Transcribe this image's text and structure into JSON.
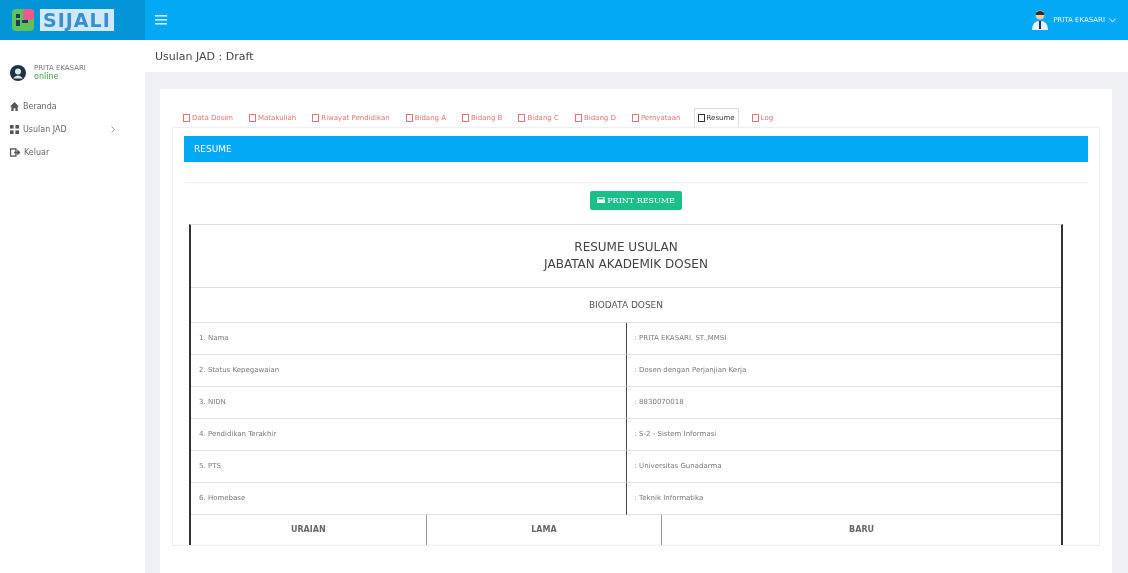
{
  "brand": {
    "name": "SIJALI"
  },
  "user_menu": {
    "name": "PRITA EKASARI"
  },
  "sidebar": {
    "user": {
      "name": "PRITA EKASARI",
      "status": "online"
    },
    "items": [
      {
        "label": "Beranda",
        "has_submenu": false
      },
      {
        "label": "Usulan JAD",
        "has_submenu": true
      },
      {
        "label": "Keluar",
        "has_submenu": false
      }
    ]
  },
  "page_title": "Usulan JAD : Draft",
  "tabs": [
    {
      "label": "Data Dosen",
      "selected": false
    },
    {
      "label": "Matakuliah",
      "selected": false
    },
    {
      "label": "Riwayat Pendidikan",
      "selected": false
    },
    {
      "label": "Bidang A",
      "selected": false
    },
    {
      "label": "Bidang B",
      "selected": false
    },
    {
      "label": "Bidang C",
      "selected": false
    },
    {
      "label": "Bidang D",
      "selected": false
    },
    {
      "label": "Pernyataan",
      "selected": false
    },
    {
      "label": "Resume",
      "selected": true
    },
    {
      "label": "Log",
      "selected": false
    }
  ],
  "section_title": "RESUME",
  "print_button": "PRINT RESUME",
  "resume": {
    "title_lines": [
      "RESUME USULAN",
      "JABATAN AKADEMIK DOSEN"
    ],
    "biodata_heading": "BIODATA DOSEN",
    "rows": [
      {
        "label": "1. Nama",
        "value": ": PRITA EKASARI, ST.,MMSI"
      },
      {
        "label": "2. Status Kepegawaian",
        "value": ": Dosen dengan Perjanjian Kerja"
      },
      {
        "label": "3. NIDN",
        "value": ": 8830070018"
      },
      {
        "label": "4. Pendidikan Terakhir",
        "value": ": S-2 - Sistem Informasi"
      },
      {
        "label": "5. PTS",
        "value": ": Universitas Gunadarma"
      },
      {
        "label": "6. Homebase",
        "value": ": Teknik Informatika"
      }
    ],
    "columns": [
      "URAIAN",
      "LAMA",
      "BARU"
    ]
  }
}
